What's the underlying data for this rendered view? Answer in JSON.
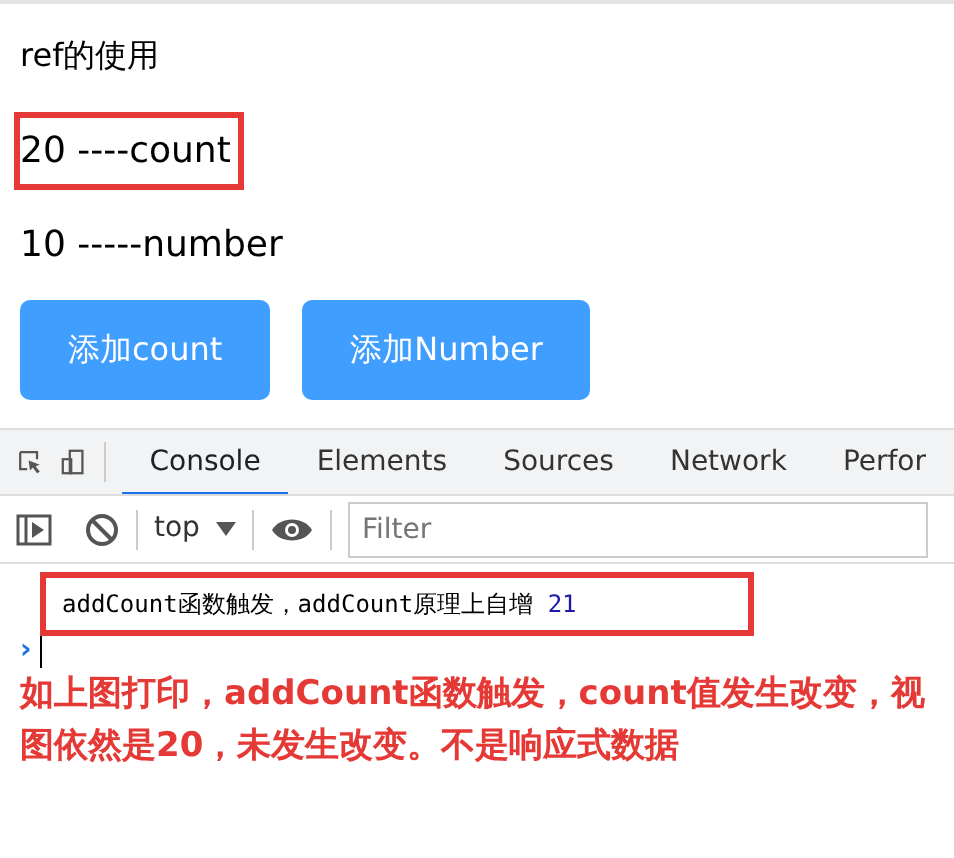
{
  "app": {
    "title": "ref的使用",
    "count_line": "20 ----count",
    "count_highlighted": true,
    "number_line": "10 -----number",
    "buttons": [
      "添加count",
      "添加Number"
    ]
  },
  "devtools": {
    "tabs": [
      {
        "label": "Console",
        "selected": true
      },
      {
        "label": "Elements",
        "selected": false
      },
      {
        "label": "Sources",
        "selected": false
      },
      {
        "label": "Network",
        "selected": false
      },
      {
        "label": "Perfor",
        "selected": false
      }
    ],
    "context": "top",
    "filter": {
      "placeholder": "Filter"
    },
    "log": {
      "message": "addCount函数触发，addCount原理上自增",
      "value": "21",
      "highlighted": true
    },
    "prompt": "›"
  },
  "annotation": "如上图打印，addCount函数触发，count值发生改变，视图依然是20，未发生改变。不是响应式数据"
}
